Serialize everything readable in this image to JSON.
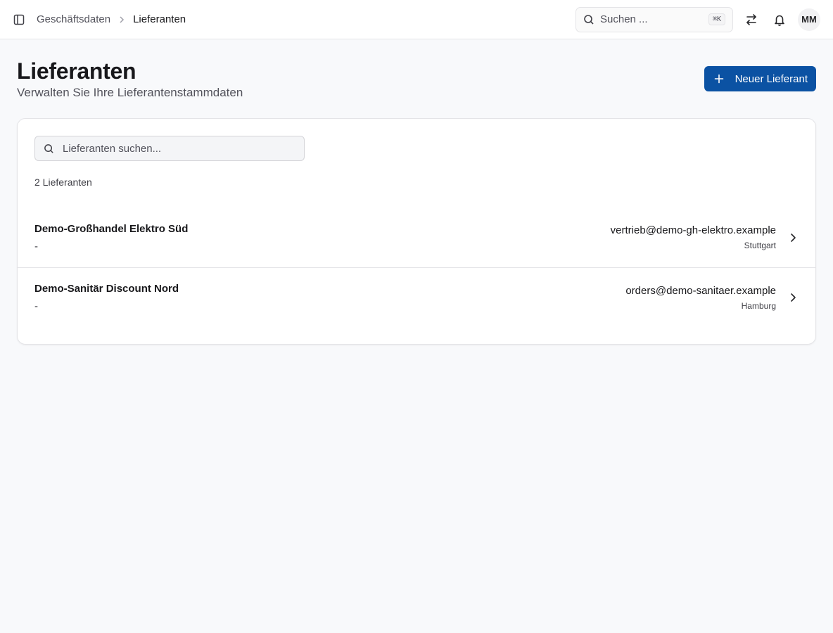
{
  "header": {
    "breadcrumb": {
      "parent": "Geschäftsdaten",
      "current": "Lieferanten"
    },
    "search": {
      "placeholder": "Suchen ...",
      "shortcut": "⌘K"
    },
    "avatar_initials": "MM",
    "icons": {
      "sidebar_toggle": "sidebar-panel-icon",
      "switch": "arrows-left-right-icon",
      "notifications": "bell-icon"
    }
  },
  "page": {
    "title": "Lieferanten",
    "subtitle": "Verwalten Sie Ihre Lieferantenstammdaten",
    "new_button_label": "Neuer Lieferant"
  },
  "list": {
    "search_placeholder": "Lieferanten suchen...",
    "count_label": "2 Lieferanten",
    "items": [
      {
        "name": "Demo-Großhandel Elektro Süd",
        "subtitle": "-",
        "email": "vertrieb@demo-gh-elektro.example",
        "city": "Stuttgart"
      },
      {
        "name": "Demo-Sanitär Discount Nord",
        "subtitle": "-",
        "email": "orders@demo-sanitaer.example",
        "city": "Hamburg"
      }
    ]
  },
  "colors": {
    "primary": "#0b52a3",
    "background": "#f8f9fb",
    "border": "#e4e4e7"
  }
}
